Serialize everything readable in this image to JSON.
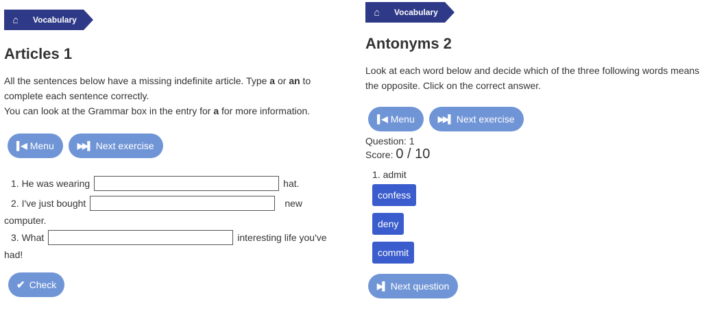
{
  "left": {
    "breadcrumb": {
      "home_icon": "home-icon",
      "label": "Vocabulary"
    },
    "title": "Articles 1",
    "instructions": {
      "part1": "All the sentences below have a missing indefinite article. Type ",
      "a": "a",
      "or": " or ",
      "an": "an",
      "part2": " to complete each sentence correctly.",
      "line2_part1": "You can look at the Grammar box in the entry for ",
      "line2_bold": "a",
      "line2_part2": " for more information."
    },
    "buttons": {
      "menu": "Menu",
      "next": "Next exercise",
      "check": "Check"
    },
    "questions": [
      {
        "before": "1. He was wearing",
        "value": "",
        "after": "hat.",
        "wrap": ""
      },
      {
        "before": "2. I've just bought",
        "value": "",
        "after": "new",
        "wrap": "computer."
      },
      {
        "before": "3. What",
        "value": "",
        "after": "interesting life you've",
        "wrap": "had!"
      }
    ]
  },
  "right": {
    "breadcrumb": {
      "home_icon": "home-icon",
      "label": "Vocabulary"
    },
    "title": "Antonyms 2",
    "instructions": "Look at each word below and decide which of the three following words means the opposite. Click on the correct answer.",
    "buttons": {
      "menu": "Menu",
      "next": "Next exercise",
      "next_question": "Next question"
    },
    "question_label": "Question: 1",
    "score_label": "Score: ",
    "score_value": "0 / 10",
    "word": "1. admit",
    "options": [
      "confess",
      "deny",
      "commit"
    ]
  }
}
